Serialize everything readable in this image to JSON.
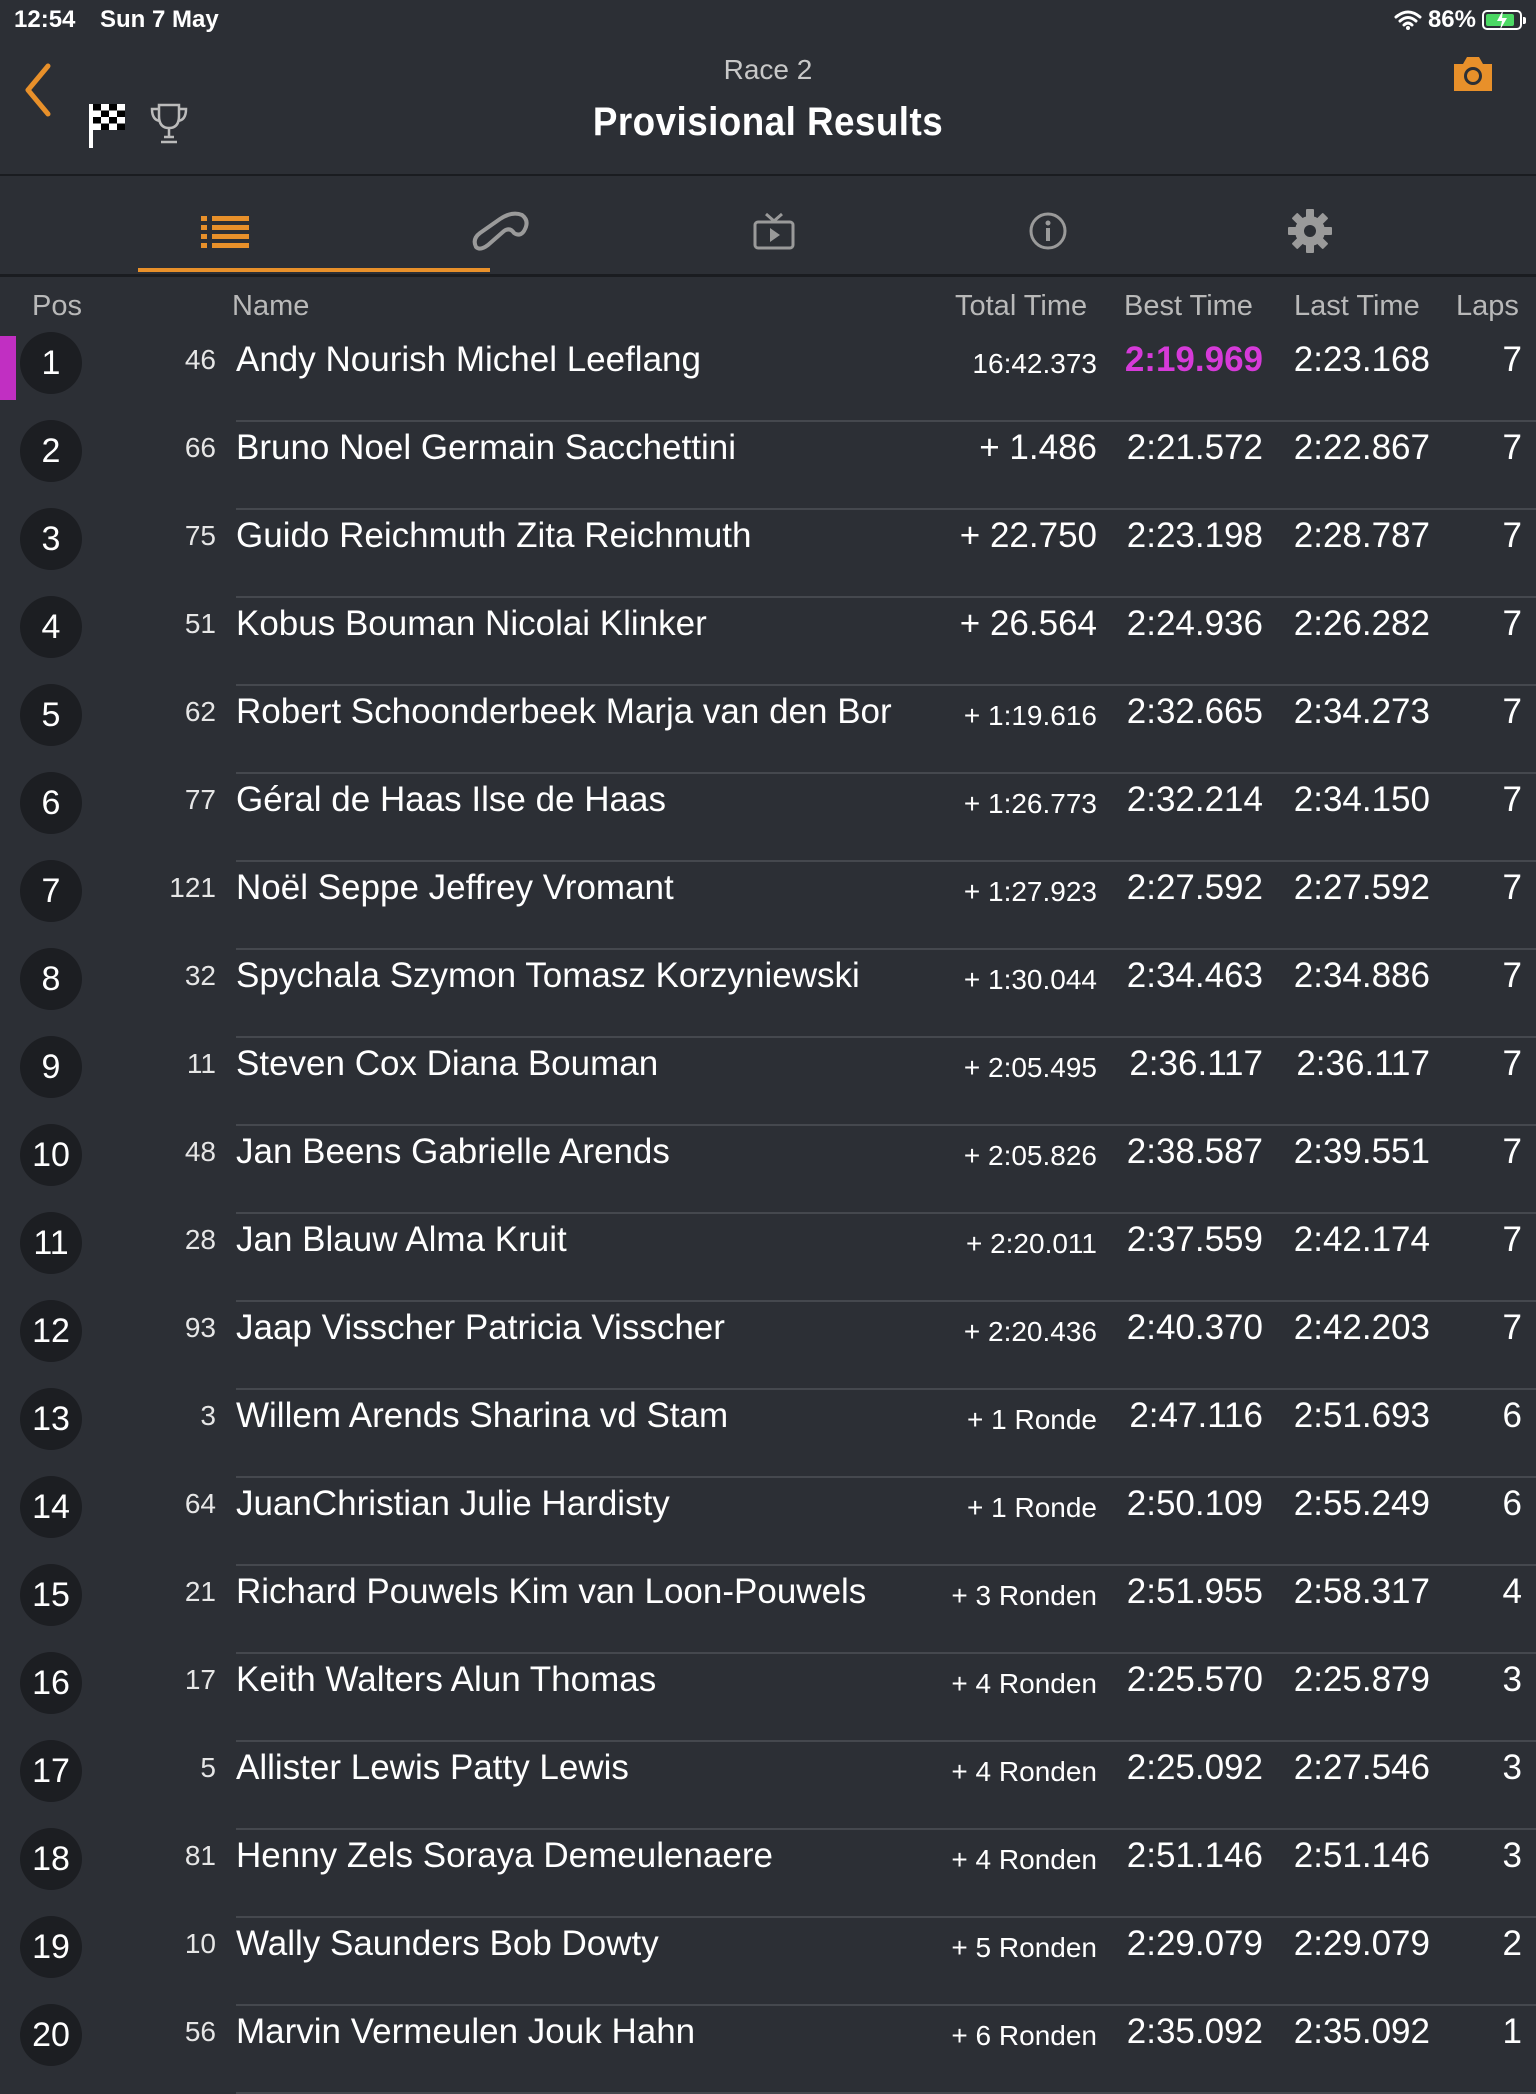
{
  "status_bar": {
    "time": "12:54",
    "date": "Sun 7 May",
    "battery": "86%",
    "battery_level": 0.86
  },
  "header": {
    "race": "Race 2",
    "title": "Provisional Results"
  },
  "tabs": [
    {
      "icon": "list-icon",
      "active": true
    },
    {
      "icon": "track-icon",
      "active": false
    },
    {
      "icon": "tv-icon",
      "active": false
    },
    {
      "icon": "info-icon",
      "active": false
    },
    {
      "icon": "gear-icon",
      "active": false
    }
  ],
  "colors": {
    "accent": "#e8902a",
    "fastest": "#d63ad9",
    "background": "#2c2f35"
  },
  "columns": {
    "pos": "Pos",
    "name": "Name",
    "total": "Total Time",
    "best": "Best Time",
    "last": "Last Time",
    "laps": "Laps"
  },
  "results": [
    {
      "pos": "1",
      "num": "46",
      "name": "Andy Nourish Michel Leeflang",
      "total": "16:42.373",
      "best": "2:19.969",
      "last": "2:23.168",
      "laps": "7",
      "fastest": true
    },
    {
      "pos": "2",
      "num": "66",
      "name": "Bruno Noel Germain Sacchettini",
      "total": "+ 1.486",
      "best": "2:21.572",
      "last": "2:22.867",
      "laps": "7"
    },
    {
      "pos": "3",
      "num": "75",
      "name": "Guido Reichmuth Zita Reichmuth",
      "total": "+ 22.750",
      "best": "2:23.198",
      "last": "2:28.787",
      "laps": "7"
    },
    {
      "pos": "4",
      "num": "51",
      "name": "Kobus Bouman Nicolai Klinker",
      "total": "+ 26.564",
      "best": "2:24.936",
      "last": "2:26.282",
      "laps": "7"
    },
    {
      "pos": "5",
      "num": "62",
      "name": "Robert Schoonderbeek Marja van den Bor",
      "total": "+ 1:19.616",
      "best": "2:32.665",
      "last": "2:34.273",
      "laps": "7"
    },
    {
      "pos": "6",
      "num": "77",
      "name": "Géral de Haas Ilse de Haas",
      "total": "+ 1:26.773",
      "best": "2:32.214",
      "last": "2:34.150",
      "laps": "7"
    },
    {
      "pos": "7",
      "num": "121",
      "name": "Noël Seppe Jeffrey Vromant",
      "total": "+ 1:27.923",
      "best": "2:27.592",
      "last": "2:27.592",
      "laps": "7"
    },
    {
      "pos": "8",
      "num": "32",
      "name": "Spychala Szymon Tomasz Korzyniewski",
      "total": "+ 1:30.044",
      "best": "2:34.463",
      "last": "2:34.886",
      "laps": "7"
    },
    {
      "pos": "9",
      "num": "11",
      "name": "Steven Cox Diana Bouman",
      "total": "+ 2:05.495",
      "best": "2:36.117",
      "last": "2:36.117",
      "laps": "7"
    },
    {
      "pos": "10",
      "num": "48",
      "name": "Jan Beens Gabrielle Arends",
      "total": "+ 2:05.826",
      "best": "2:38.587",
      "last": "2:39.551",
      "laps": "7"
    },
    {
      "pos": "11",
      "num": "28",
      "name": "Jan Blauw Alma Kruit",
      "total": "+ 2:20.011",
      "best": "2:37.559",
      "last": "2:42.174",
      "laps": "7"
    },
    {
      "pos": "12",
      "num": "93",
      "name": "Jaap Visscher Patricia Visscher",
      "total": "+ 2:20.436",
      "best": "2:40.370",
      "last": "2:42.203",
      "laps": "7"
    },
    {
      "pos": "13",
      "num": "3",
      "name": "Willem Arends Sharina vd Stam",
      "total": "+ 1 Ronde",
      "best": "2:47.116",
      "last": "2:51.693",
      "laps": "6"
    },
    {
      "pos": "14",
      "num": "64",
      "name": "JuanChristian Julie Hardisty",
      "total": "+ 1 Ronde",
      "best": "2:50.109",
      "last": "2:55.249",
      "laps": "6"
    },
    {
      "pos": "15",
      "num": "21",
      "name": "Richard Pouwels Kim van Loon-Pouwels",
      "total": "+ 3 Ronden",
      "best": "2:51.955",
      "last": "2:58.317",
      "laps": "4"
    },
    {
      "pos": "16",
      "num": "17",
      "name": "Keith Walters Alun Thomas",
      "total": "+ 4 Ronden",
      "best": "2:25.570",
      "last": "2:25.879",
      "laps": "3"
    },
    {
      "pos": "17",
      "num": "5",
      "name": "Allister Lewis Patty Lewis",
      "total": "+ 4 Ronden",
      "best": "2:25.092",
      "last": "2:27.546",
      "laps": "3"
    },
    {
      "pos": "18",
      "num": "81",
      "name": "Henny Zels Soraya Demeulenaere",
      "total": "+ 4 Ronden",
      "best": "2:51.146",
      "last": "2:51.146",
      "laps": "3"
    },
    {
      "pos": "19",
      "num": "10",
      "name": "Wally Saunders Bob Dowty",
      "total": "+ 5 Ronden",
      "best": "2:29.079",
      "last": "2:29.079",
      "laps": "2"
    },
    {
      "pos": "20",
      "num": "56",
      "name": "Marvin Vermeulen Jouk Hahn",
      "total": "+ 6 Ronden",
      "best": "2:35.092",
      "last": "2:35.092",
      "laps": "1"
    }
  ]
}
